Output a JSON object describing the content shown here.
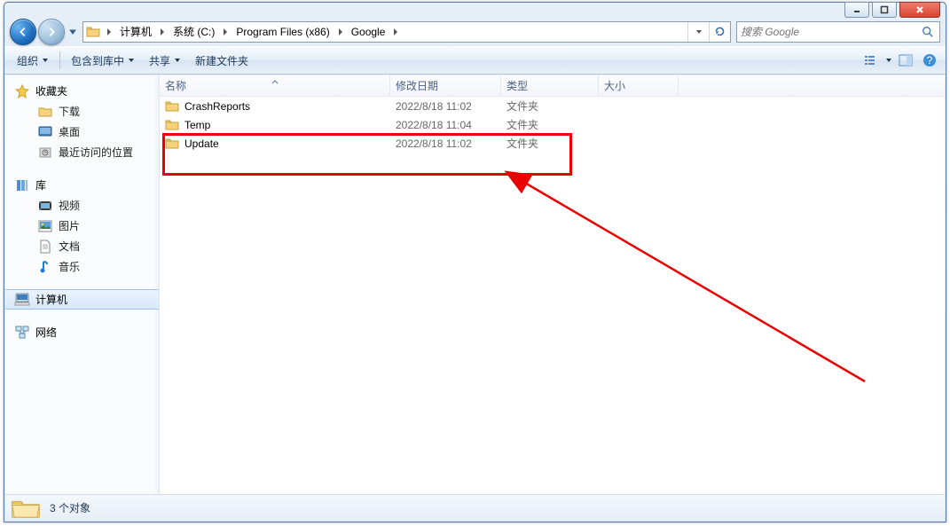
{
  "window_buttons": {
    "min": "minimize",
    "max": "maximize",
    "close": "close"
  },
  "breadcrumbs": [
    "计算机",
    "系统 (C:)",
    "Program Files (x86)",
    "Google"
  ],
  "search": {
    "placeholder": "搜索 Google"
  },
  "toolbar": {
    "organize": "组织",
    "include": "包含到库中",
    "share": "共享",
    "newfolder": "新建文件夹"
  },
  "sidebar": {
    "favorites": {
      "label": "收藏夹",
      "items": [
        "下载",
        "桌面",
        "最近访问的位置"
      ]
    },
    "libraries": {
      "label": "库",
      "items": [
        "视频",
        "图片",
        "文档",
        "音乐"
      ]
    },
    "computer": {
      "label": "计算机"
    },
    "network": {
      "label": "网络"
    }
  },
  "columns": {
    "name": "名称",
    "date": "修改日期",
    "type": "类型",
    "size": "大小"
  },
  "rows": [
    {
      "name": "CrashReports",
      "date": "2022/8/18 11:02",
      "type": "文件夹",
      "size": ""
    },
    {
      "name": "Temp",
      "date": "2022/8/18 11:04",
      "type": "文件夹",
      "size": ""
    },
    {
      "name": "Update",
      "date": "2022/8/18 11:02",
      "type": "文件夹",
      "size": ""
    }
  ],
  "status": {
    "text": "3 个对象"
  }
}
